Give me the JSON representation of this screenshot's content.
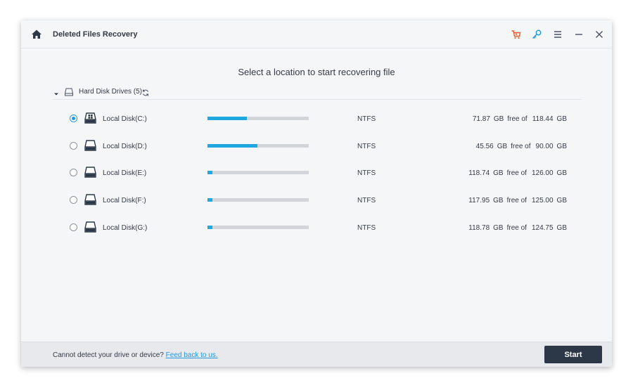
{
  "app": {
    "title": "Deleted Files Recovery"
  },
  "toolbar": {
    "icons": [
      "home-icon",
      "cart-icon",
      "key-icon",
      "menu-icon",
      "minimize-icon",
      "close-icon"
    ],
    "accent_cart": "#e6582a",
    "accent_key": "#1f9ae0"
  },
  "main": {
    "heading": "Select a location to start recovering file",
    "group": {
      "label": "Hard Disk Drives (5)"
    },
    "drives": [
      {
        "name": "Local Disk(C:)",
        "fs": "NTFS",
        "free": "71.87",
        "total": "118.44",
        "used_fraction": 0.39,
        "selected": true,
        "system": true
      },
      {
        "name": "Local Disk(D:)",
        "fs": "NTFS",
        "free": "45.56",
        "total": "90.00",
        "used_fraction": 0.49,
        "selected": false,
        "system": false
      },
      {
        "name": "Local Disk(E:)",
        "fs": "NTFS",
        "free": "118.74",
        "total": "126.00",
        "used_fraction": 0.05,
        "selected": false,
        "system": false
      },
      {
        "name": "Local Disk(F:)",
        "fs": "NTFS",
        "free": "117.95",
        "total": "125.00",
        "used_fraction": 0.05,
        "selected": false,
        "system": false
      },
      {
        "name": "Local Disk(G:)",
        "fs": "NTFS",
        "free": "118.78",
        "total": "124.75",
        "used_fraction": 0.05,
        "selected": false,
        "system": false
      }
    ],
    "units": {
      "gb": "GB",
      "free_of": "free of"
    }
  },
  "footer": {
    "text": "Cannot detect your drive or device?",
    "link": "Feed back to us.",
    "start_label": "Start"
  },
  "colors": {
    "bar_fill": "#1fa7e0",
    "bar_track": "#d2d5da",
    "start_button": "#2c3848"
  }
}
